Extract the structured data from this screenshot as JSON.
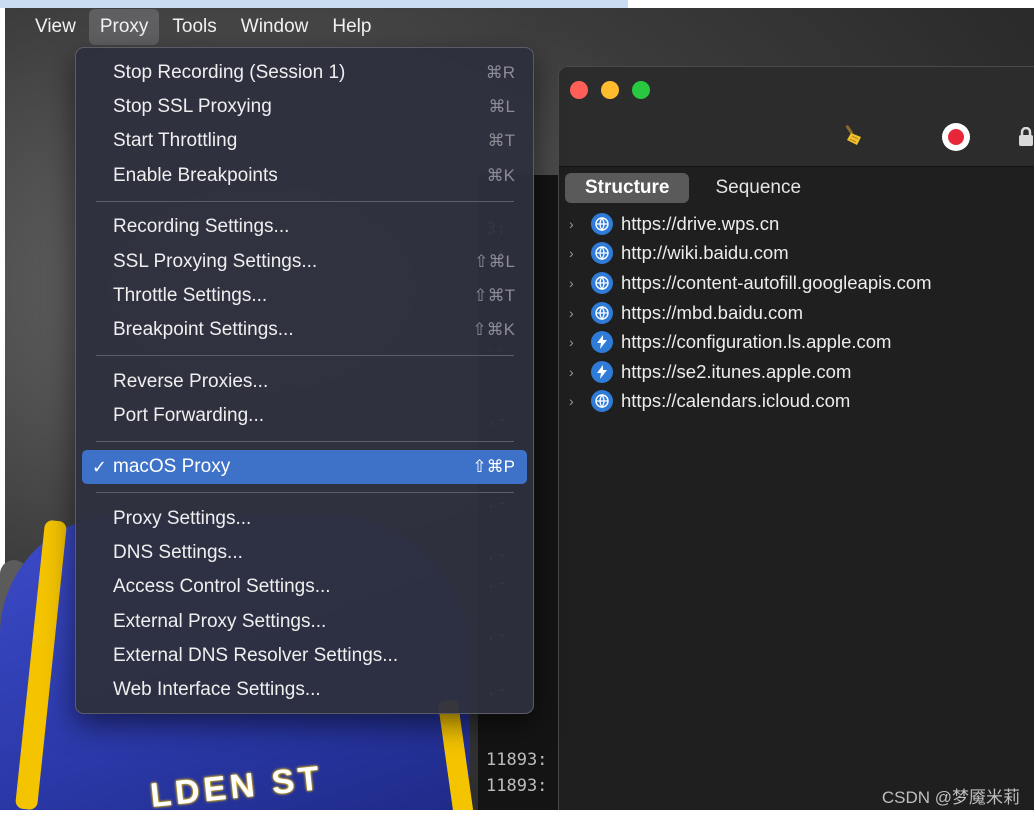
{
  "menubar": {
    "items": [
      {
        "label": "View"
      },
      {
        "label": "Proxy",
        "active": true
      },
      {
        "label": "Tools"
      },
      {
        "label": "Window"
      },
      {
        "label": "Help"
      }
    ]
  },
  "proxy_menu": {
    "items": [
      {
        "label": "Stop Recording (Session 1)",
        "shortcut": "⌘R"
      },
      {
        "label": "Stop SSL Proxying",
        "shortcut": "⌘L"
      },
      {
        "label": "Start Throttling",
        "shortcut": "⌘T"
      },
      {
        "label": "Enable Breakpoints",
        "shortcut": "⌘K"
      },
      {
        "label": "Recording Settings...",
        "shortcut": ""
      },
      {
        "label": "SSL Proxying Settings...",
        "shortcut": "⇧⌘L"
      },
      {
        "label": "Throttle Settings...",
        "shortcut": "⇧⌘T"
      },
      {
        "label": "Breakpoint Settings...",
        "shortcut": "⇧⌘K"
      },
      {
        "label": "Reverse Proxies...",
        "shortcut": ""
      },
      {
        "label": "Port Forwarding...",
        "shortcut": ""
      },
      {
        "label": "macOS Proxy",
        "shortcut": "⇧⌘P",
        "checked": true,
        "check_mark": "✓"
      },
      {
        "label": "Proxy Settings...",
        "shortcut": ""
      },
      {
        "label": "DNS Settings...",
        "shortcut": ""
      },
      {
        "label": "Access Control Settings...",
        "shortcut": ""
      },
      {
        "label": "External Proxy Settings...",
        "shortcut": ""
      },
      {
        "label": "External DNS Resolver Settings...",
        "shortcut": ""
      },
      {
        "label": "Web Interface Settings...",
        "shortcut": ""
      }
    ]
  },
  "terminal": {
    "lines": [
      "3:",
      "it",
      "``",
      ".-",
      ".-",
      ".-",
      ".-",
      ".-",
      ".-",
      ".-",
      "11893:",
      "11893:"
    ]
  },
  "charles": {
    "tabs": [
      {
        "label": "Structure",
        "active": true
      },
      {
        "label": "Sequence"
      }
    ],
    "hosts": [
      {
        "label": "https://drive.wps.cn",
        "icon": "globe-icon"
      },
      {
        "label": "http://wiki.baidu.com",
        "icon": "globe-icon"
      },
      {
        "label": "https://content-autofill.googleapis.com",
        "icon": "globe-icon"
      },
      {
        "label": "https://mbd.baidu.com",
        "icon": "globe-icon"
      },
      {
        "label": "https://configuration.ls.apple.com",
        "icon": "lightning-icon"
      },
      {
        "label": "https://se2.itunes.apple.com",
        "icon": "lightning-icon"
      },
      {
        "label": "https://calendars.icloud.com",
        "icon": "globe-icon"
      }
    ]
  },
  "background": {
    "jersey_text": "LDEN ST"
  },
  "watermark": "CSDN @梦魇米莉",
  "colors": {
    "menu_highlight": "#3e72c8",
    "record_red": "#e8263a",
    "host_icon_blue": "#2f7bd8"
  }
}
